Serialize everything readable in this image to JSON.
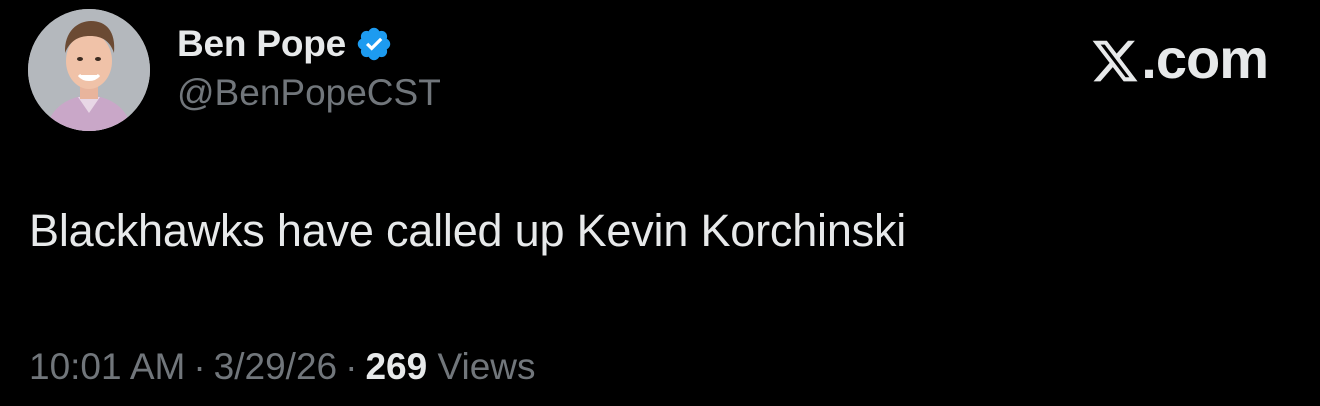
{
  "author": {
    "display_name": "Ben Pope",
    "handle": "@BenPopeCST",
    "verified": true,
    "verified_badge_color": "#1d9bf0",
    "avatar_icon": "person-avatar"
  },
  "brand": {
    "logo_text": ".com",
    "logo_icon": "x-logo-icon"
  },
  "tweet": {
    "text": "Blackhawks have called up Kevin Korchinski"
  },
  "meta": {
    "time": "10:01 AM",
    "separator": "·",
    "date": "3/29/26",
    "views_count": "269",
    "views_label": "Views"
  },
  "colors": {
    "background": "#000000",
    "primary_text": "#e7e9ea",
    "secondary_text": "#71767b"
  }
}
